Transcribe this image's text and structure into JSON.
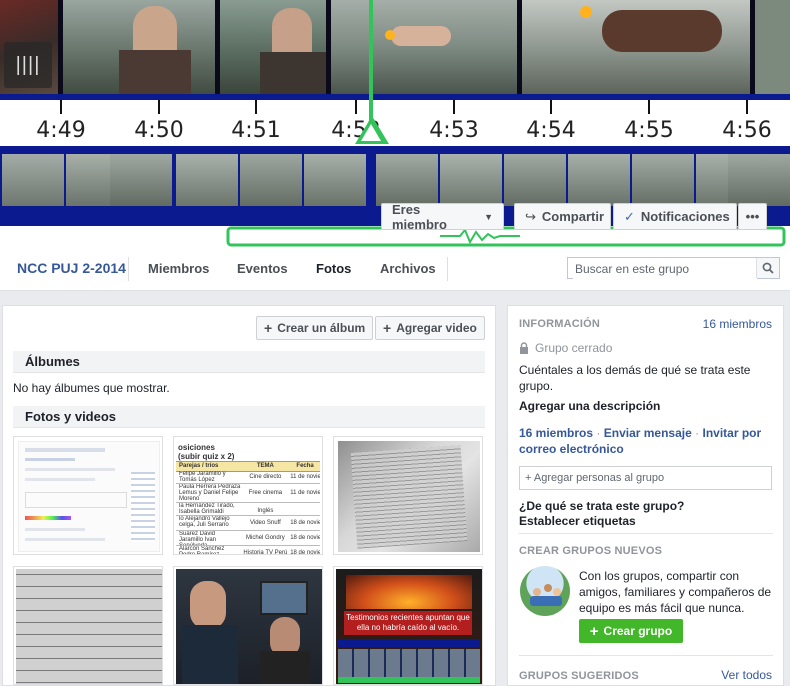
{
  "cover": {
    "timecodes": [
      "4:49",
      "4:50",
      "4:51",
      "4:52",
      "4:53",
      "4:54",
      "4:55",
      "4:56"
    ],
    "member_button": "Eres miembro",
    "share_button": "Compartir",
    "notifications_button": "Notificaciones",
    "more_button": "•••"
  },
  "nav": {
    "group_name": "NCC PUJ 2-2014",
    "tabs": [
      {
        "label": "Miembros"
      },
      {
        "label": "Eventos"
      },
      {
        "label": "Fotos"
      },
      {
        "label": "Archivos"
      }
    ],
    "search_placeholder": "Buscar en este grupo"
  },
  "main": {
    "create_album_button": "Crear un álbum",
    "add_video_button": "Agregar video",
    "albums_heading": "Álbumes",
    "albums_empty": "No hay álbumes que mostrar.",
    "photos_heading": "Fotos y videos",
    "thumb_caption": "Testimonios recientes apuntan que ella no habría caído al vacío.",
    "table_header": "osiciones (subir quiz x 2)",
    "table_cols": [
      "Parejas / tríos",
      "TEMA",
      "Fecha"
    ],
    "table_rows": [
      [
        "Felipe Jaramillo y Tomás López",
        "Cine directo",
        "11 de novie"
      ],
      [
        "Paula Herrera Pedraza Lemus y Daniel Felipe Moreno",
        "Free cinema Inglés",
        "11 de novie"
      ],
      [
        "la Hernández Tirado, Isabella Grimaldi",
        "",
        ""
      ],
      [
        "lo Alejandro Vallejo celga, Juli Serrano",
        "Video Snuff",
        "18 de novie"
      ],
      [
        "Suárez David Jaramillo Ivan Sepúlveda",
        "Michel Gondry",
        "18 de novie"
      ],
      [
        "Alarcón Sánchez Pedro Ramírez",
        "Historia TV Perú",
        "18 de novie"
      ]
    ]
  },
  "side": {
    "info_heading": "INFORMACIÓN",
    "members_count": "16 miembros",
    "group_type": "Grupo cerrado",
    "description": "Cuéntales a los demás de qué se trata este grupo.",
    "add_description": "Agregar una descripción",
    "members_link": "16 miembros",
    "send_message": "Enviar mensaje",
    "invite_email": "Invitar por correo electrónico",
    "add_people_placeholder": "+ Agregar personas al grupo",
    "what_about": "¿De qué se trata este grupo?",
    "set_tags": "Establecer etiquetas",
    "create_heading": "CREAR GRUPOS NUEVOS",
    "create_text": "Con los grupos, compartir con amigos, familiares y compañeros de equipo es más fácil que nunca.",
    "create_button": "Crear grupo",
    "suggested_heading": "GRUPOS SUGERIDOS",
    "see_all": "Ver todos"
  }
}
